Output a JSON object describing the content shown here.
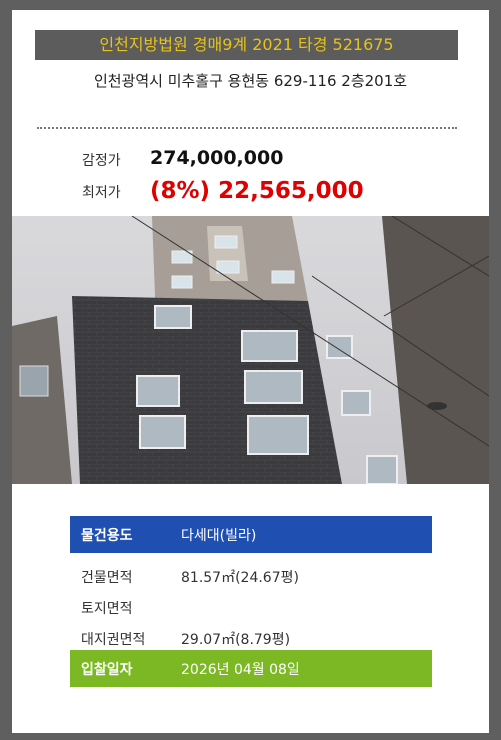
{
  "header": {
    "title": "인천지방법원 경매9계 2021 타경 521675",
    "address": "인천광역시 미추홀구 용현동 629-116 2층201호"
  },
  "prices": {
    "appraisal_label": "감정가",
    "appraisal_value": "274,000,000",
    "minimum_label": "최저가",
    "minimum_value": "(8%) 22,565,000"
  },
  "details": [
    {
      "label": "물건용도",
      "value": "다세대(빌라)"
    },
    {
      "label": "건물면적",
      "value": "81.57㎡(24.67평)"
    },
    {
      "label": "토지면적",
      "value": ""
    },
    {
      "label": "대지권면적",
      "value": "29.07㎡(8.79평)"
    },
    {
      "label": "입찰일자",
      "value": "2026년 04월 08일"
    }
  ],
  "colors": {
    "title_bg": "#5c5c5c",
    "title_text": "#e8c21c",
    "minimum_price": "#e00000",
    "usage_row": "#1f4fb0",
    "bid_date_row": "#7bb824"
  }
}
